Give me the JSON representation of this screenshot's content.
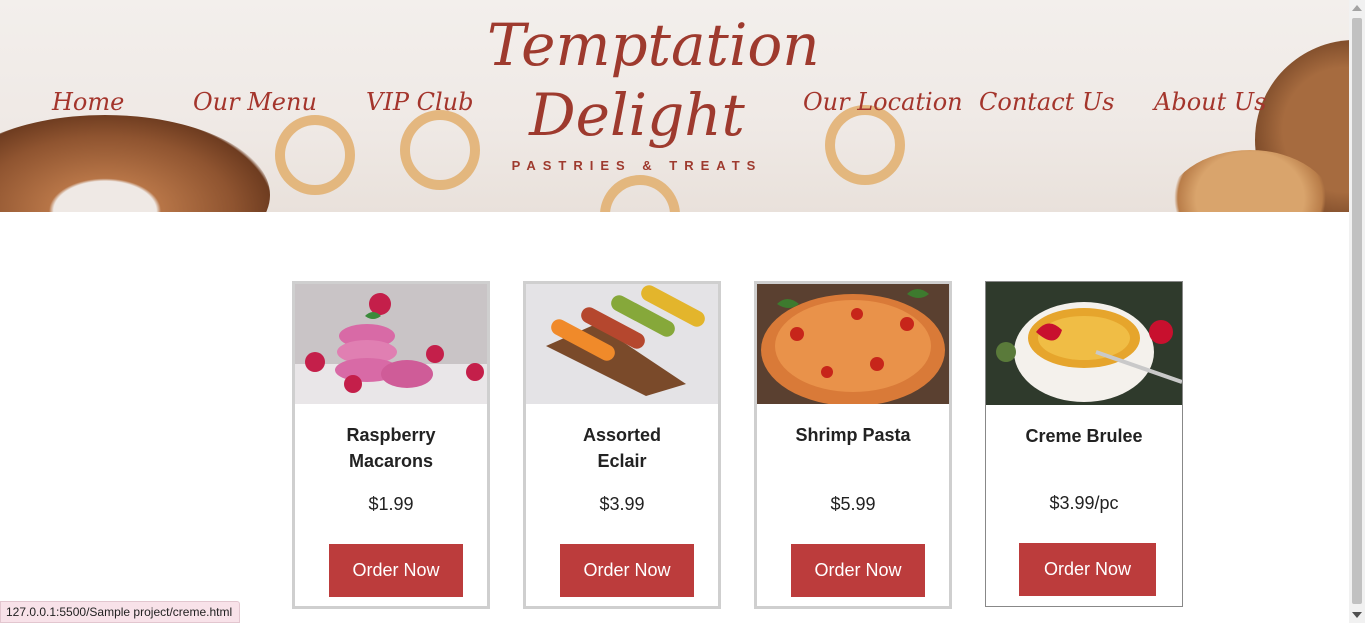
{
  "nav": {
    "home": "Home",
    "menu": "Our Menu",
    "vip": "VIP Club",
    "location": "Our Location",
    "contact": "Contact Us",
    "about": "About Us"
  },
  "logo": {
    "line1": "Temptation",
    "line2": "Delight",
    "tagline": "PASTRIES & TREATS"
  },
  "products": [
    {
      "name": "Raspberry Macarons",
      "price": "$1.99",
      "button": "Order Now",
      "image": "raspberry-macarons-photo"
    },
    {
      "name": "Assorted Eclair",
      "price": "$3.99",
      "button": "Order Now",
      "image": "assorted-eclair-photo"
    },
    {
      "name": "Shrimp Pasta",
      "price": "$5.99",
      "button": "Order Now",
      "image": "shrimp-pasta-photo"
    },
    {
      "name": "Creme Brulee",
      "price": "$3.99/pc",
      "button": "Order Now",
      "image": "creme-brulee-photo"
    }
  ],
  "status_bar": {
    "url": "127.0.0.1:5500/Sample project/creme.html"
  },
  "colors": {
    "brand": "#a4352c",
    "button": "#bc3c3c"
  }
}
